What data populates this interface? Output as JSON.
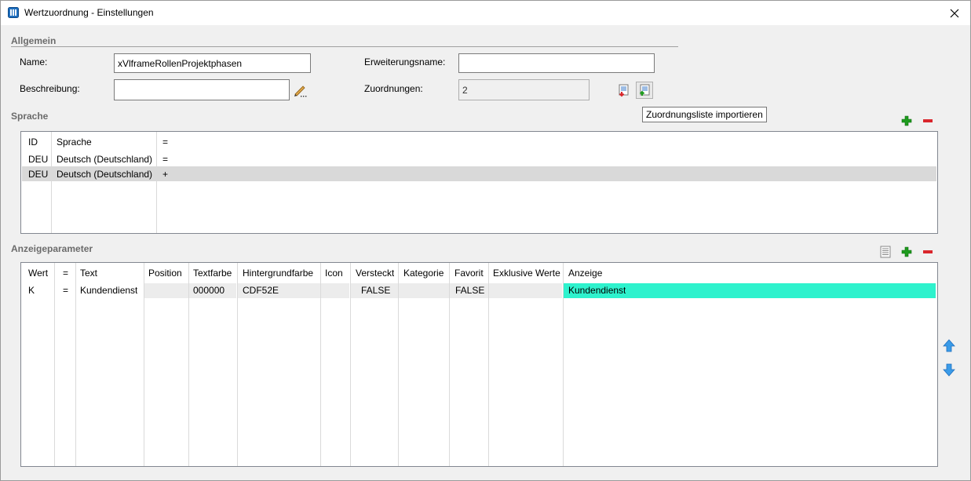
{
  "window": {
    "title": "Wertzuordnung - Einstellungen"
  },
  "sections": {
    "allgemein": "Allgemein",
    "sprache": "Sprache",
    "anzeigeparameter": "Anzeigeparameter"
  },
  "fields": {
    "name_label": "Name:",
    "name_value": "xVlframeRollenProjektphasen",
    "beschreibung_label": "Beschreibung:",
    "beschreibung_value": "",
    "erweiterungsname_label": "Erweiterungsname:",
    "erweiterungsname_value": "",
    "zuordnungen_label": "Zuordnungen:",
    "zuordnungen_value": "2"
  },
  "tooltip": "Zuordnungsliste importieren",
  "sprache_table": {
    "headers": [
      "ID",
      "Sprache",
      "="
    ],
    "rows": [
      [
        "DEU",
        "Deutsch (Deutschland)",
        "="
      ],
      [
        "DEU",
        "Deutsch (Deutschland)",
        "+"
      ]
    ]
  },
  "anzeige_table": {
    "headers": [
      "Wert",
      "=",
      "Text",
      "Position",
      "Textfarbe",
      "Hintergrundfarbe",
      "Icon",
      "Versteckt",
      "Kategorie",
      "Favorit",
      "Exklusive Werte",
      "Anzeige"
    ],
    "rows": [
      [
        "K",
        "=",
        "Kundendienst",
        "",
        "000000",
        "CDF52E",
        "",
        "FALSE",
        "",
        "FALSE",
        "",
        "Kundendienst"
      ]
    ]
  },
  "colors": {
    "anzeige_highlight": "#2ef2cd",
    "selected_row": "#d9d9d9",
    "add_icon": "#1e9b1e",
    "remove_icon": "#d9262c",
    "arrow_icon": "#2f8fdc"
  },
  "icons": [
    "app-icon",
    "close-icon",
    "pencil-icon",
    "export-list-icon",
    "import-list-icon",
    "add-icon",
    "remove-icon",
    "list-icon",
    "arrow-up-icon",
    "arrow-down-icon"
  ]
}
